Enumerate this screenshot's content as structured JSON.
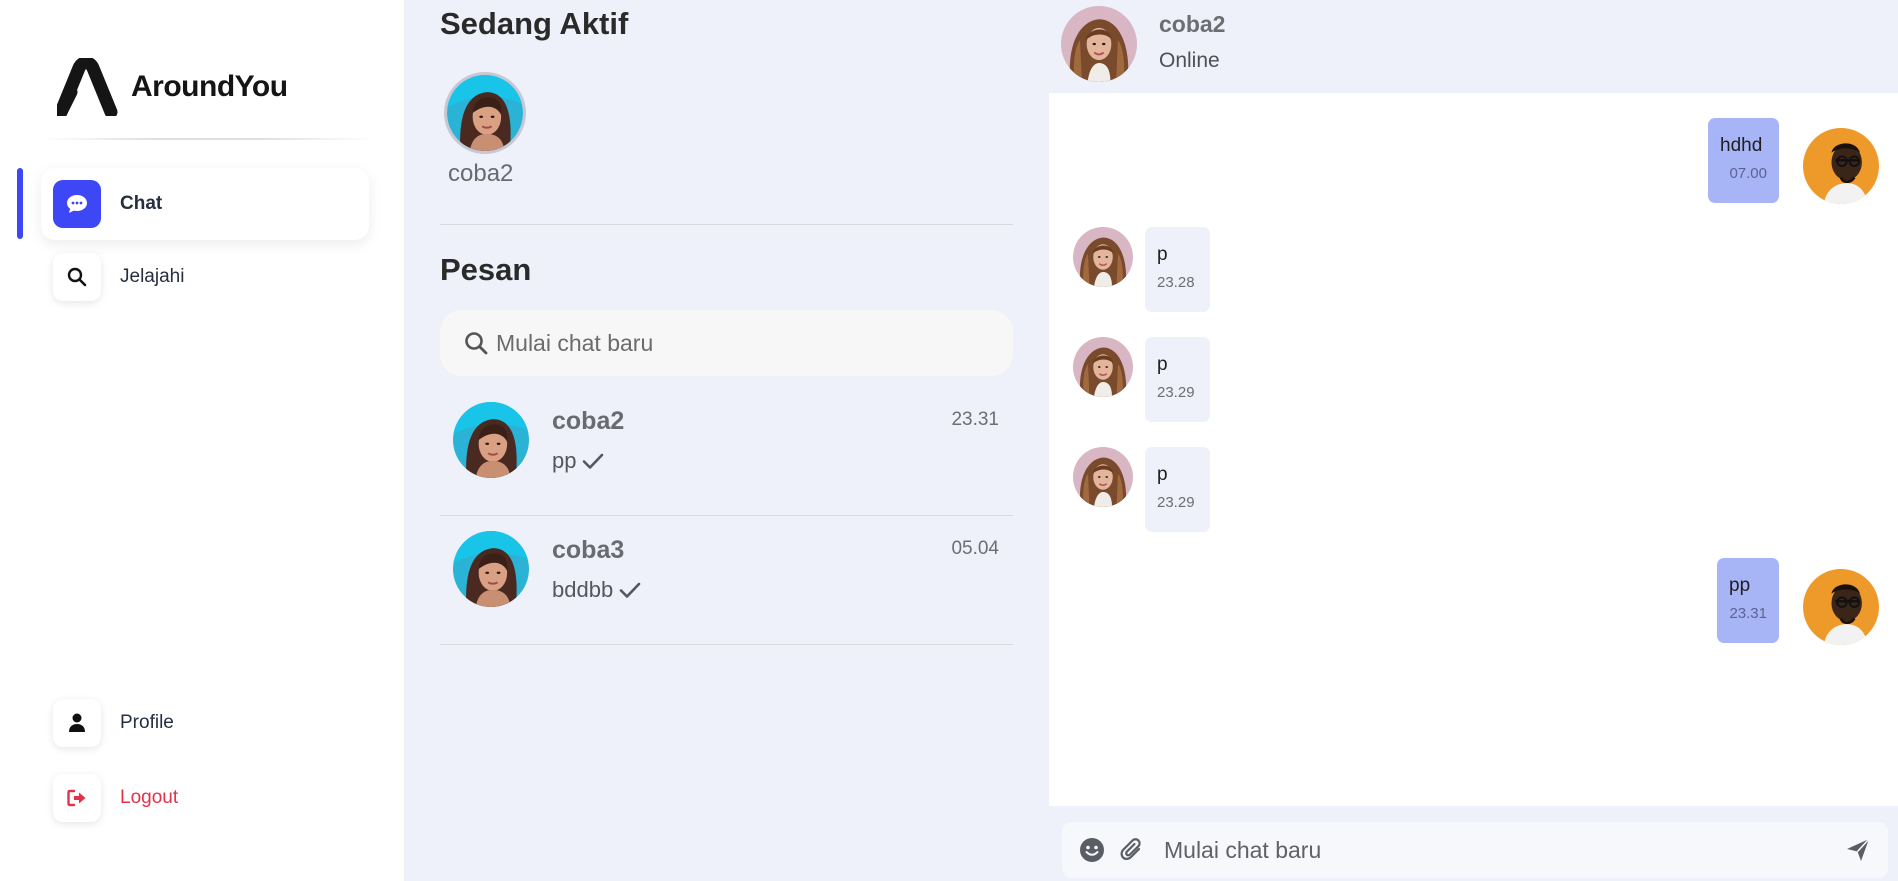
{
  "app": {
    "brand": "AroundYou"
  },
  "sidebar": {
    "items": [
      {
        "label": "Chat",
        "icon": "chat-bubble-icon",
        "active": true
      },
      {
        "label": "Jelajahi",
        "icon": "search-icon",
        "active": false
      }
    ],
    "bottom_items": [
      {
        "label": "Profile",
        "icon": "user-icon"
      },
      {
        "label": "Logout",
        "icon": "logout-icon"
      }
    ]
  },
  "middle": {
    "active_title": "Sedang Aktif",
    "active_users": [
      {
        "name": "coba2"
      }
    ],
    "messages_title": "Pesan",
    "search": {
      "placeholder": "Mulai chat baru",
      "value": ""
    },
    "conversations": [
      {
        "name": "coba2",
        "time": "23.31",
        "last_message": "pp",
        "read_icon": "check-icon"
      },
      {
        "name": "coba3",
        "time": "05.04",
        "last_message": "bddbb",
        "read_icon": "check-icon"
      }
    ]
  },
  "chat": {
    "contact": {
      "name": "coba2",
      "status": "Online"
    },
    "messages": [
      {
        "direction": "out",
        "text": "hdhd",
        "time": "07.00"
      },
      {
        "direction": "in",
        "text": "p",
        "time": "23.28"
      },
      {
        "direction": "in",
        "text": "p",
        "time": "23.29"
      },
      {
        "direction": "in",
        "text": "p",
        "time": "23.29"
      },
      {
        "direction": "out",
        "text": "pp",
        "time": "23.31"
      }
    ],
    "input": {
      "placeholder": "Mulai chat baru",
      "value": ""
    }
  },
  "colors": {
    "accent": "#3d47f5",
    "panel_bg": "#eef1f9",
    "outgoing_bubble": "#a7b5f7",
    "logout_red": "#e0334b"
  }
}
